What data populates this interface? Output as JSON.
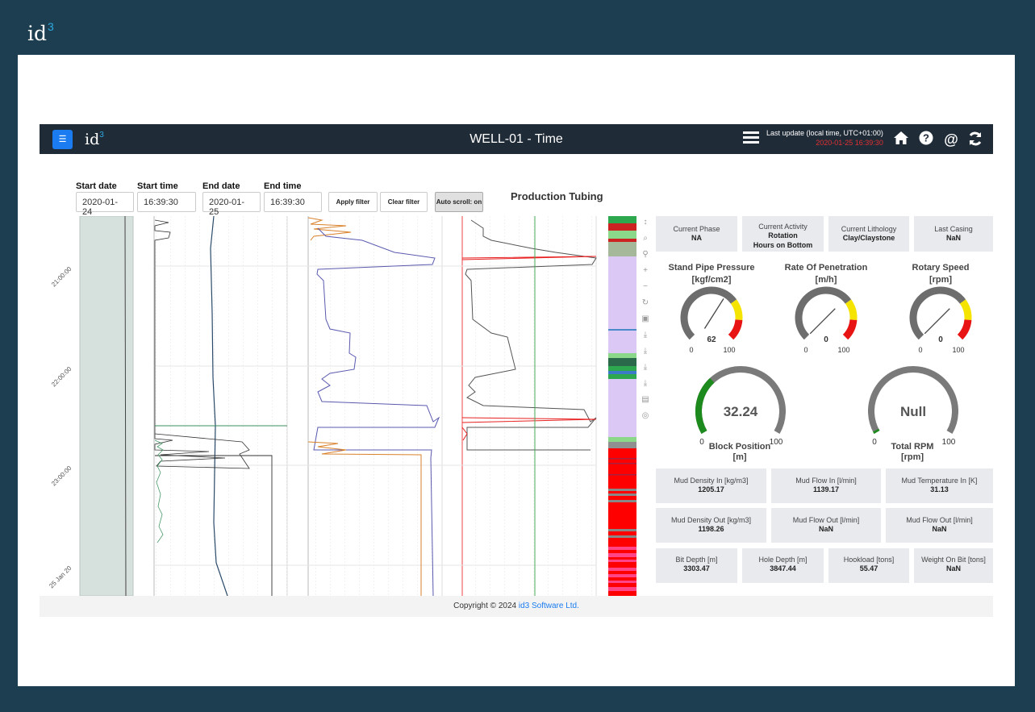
{
  "brand": {
    "name": "id",
    "sup": "3"
  },
  "nav": {
    "title": "WELL-01 - Time",
    "update_label": "Last update (local time, UTC+01:00)",
    "update_time": "2020-01-25 16:39:30"
  },
  "filters": {
    "start_date_label": "Start date",
    "start_date": "2020-01-24",
    "start_time_label": "Start time",
    "start_time": "16:39:30",
    "end_date_label": "End date",
    "end_date": "2020-01-25",
    "end_time_label": "End time",
    "end_time": "16:39:30",
    "apply": "Apply filter",
    "clear": "Clear filter",
    "autoscroll": "Auto scroll: on"
  },
  "section_title": "Production Tubing",
  "time_ticks": [
    "21:00:00",
    "22:00:00",
    "23:00:00",
    "25 Jan 20"
  ],
  "status_boxes": [
    {
      "label": "Current Phase",
      "value": "NA"
    },
    {
      "label": "Current Activity",
      "value": "Rotation",
      "value2": "Hours on Bottom"
    },
    {
      "label": "Current Lithology",
      "value": "Clay/Claystone"
    },
    {
      "label": "Last Casing",
      "value": "NaN"
    }
  ],
  "gauges": [
    {
      "title": "Stand Pipe Pressure",
      "unit": "[kgf/cm2]",
      "value": 62,
      "display": "62",
      "min": "0",
      "max": "100"
    },
    {
      "title": "Rate Of Penetration",
      "unit": "[m/h]",
      "value": 0,
      "display": "0",
      "min": "0",
      "max": "100"
    },
    {
      "title": "Rotary Speed",
      "unit": "[rpm]",
      "value": 0,
      "display": "0",
      "min": "0",
      "max": "100"
    }
  ],
  "big_gauges": [
    {
      "title": "Block Position",
      "unit": "[m]",
      "value": 32.24,
      "display": "32.24",
      "min": "0",
      "max": "100"
    },
    {
      "title": "Total RPM",
      "unit": "[rpm]",
      "value": 0,
      "display": "Null",
      "min": "0",
      "max": "100"
    }
  ],
  "mud_row1": [
    {
      "label": "Mud Density In [kg/m3]",
      "value": "1205.17"
    },
    {
      "label": "Mud Flow In [l/min]",
      "value": "1139.17"
    },
    {
      "label": "Mud Temperature In [K]",
      "value": "31.13"
    }
  ],
  "mud_row2": [
    {
      "label": "Mud Density Out [kg/m3]",
      "value": "1198.26"
    },
    {
      "label": "Mud Flow Out [l/min]",
      "value": "NaN"
    },
    {
      "label": "Mud Flow Out [l/min]",
      "value": "NaN"
    }
  ],
  "depth_row": [
    {
      "label": "Bit Depth [m]",
      "value": "3303.47"
    },
    {
      "label": "Hole Depth [m]",
      "value": "3847.44"
    },
    {
      "label": "Hookload [tons]",
      "value": "55.47"
    },
    {
      "label": "Weight On Bit [tons]",
      "value": "NaN"
    }
  ],
  "footer": {
    "text": "Copyright © 2024",
    "link": "id3 Software Ltd."
  },
  "colors": {
    "accent": "#1a7cf0",
    "nav": "#202b38",
    "frame": "#1d3e50",
    "gauge_gray": "#6d6d6d",
    "gauge_yellow": "#f5e400",
    "gauge_red": "#e81313",
    "gauge_green": "#1c8a1c"
  }
}
